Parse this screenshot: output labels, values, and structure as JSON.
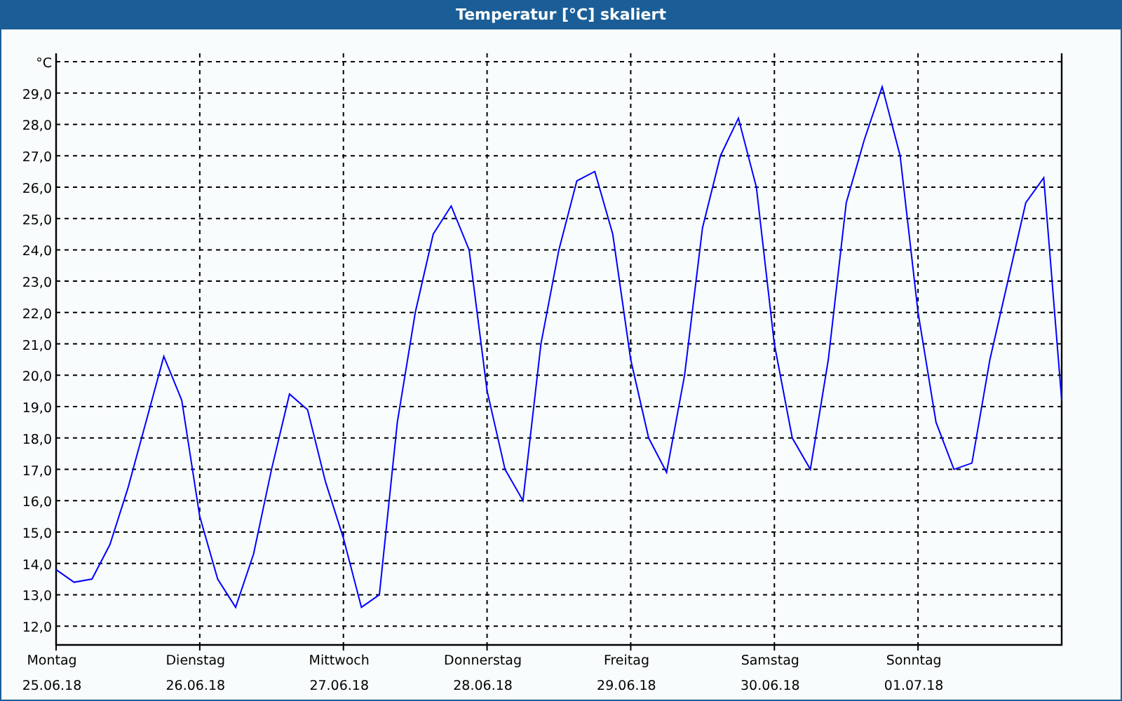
{
  "window": {
    "title": "Temperatur [°C] skaliert"
  },
  "chart": {
    "chart_data": {
      "type": "line",
      "ylabel": "°C",
      "ylim": [
        11.4,
        30
      ],
      "grid": true,
      "categories": [
        "Montag\n25.06.18",
        null,
        null,
        null,
        null,
        null,
        null,
        null,
        "Dienstag\n26.06.18",
        null,
        null,
        null,
        null,
        null,
        null,
        null,
        "Mittwoch\n27.06.18",
        null,
        null,
        null,
        null,
        null,
        null,
        null,
        "Donnerstag\n28.06.18",
        null,
        null,
        null,
        null,
        null,
        null,
        null,
        "Freitag\n29.06.18",
        null,
        null,
        null,
        null,
        null,
        null,
        null,
        "Samstag\n30.06.18",
        null,
        null,
        null,
        null,
        null,
        null,
        null,
        "Sonntag\n01.07.18",
        null,
        null,
        null,
        null,
        null,
        null,
        null,
        null
      ],
      "series": [
        {
          "color": "#0000ff",
          "values": [
            13.8,
            13.4,
            13.5,
            14.6,
            16.4,
            18.5,
            20.6,
            19.2,
            15.5,
            13.5,
            12.6,
            14.3,
            17,
            19.4,
            18.9,
            16.6,
            14.8,
            12.6,
            13,
            18.5,
            22,
            24.5,
            25.4,
            24,
            19.5,
            17,
            16,
            21,
            24,
            26.2,
            26.5,
            24.5,
            20.5,
            18,
            16.9,
            20,
            24.7,
            27,
            28.2,
            26,
            21,
            18,
            17,
            20.5,
            25.5,
            27.5,
            29.2,
            27,
            22,
            18.5,
            17,
            17.2,
            20.5,
            23,
            25.5,
            26.3,
            19.2
          ]
        }
      ],
      "yticks": [
        {
          "value": 12,
          "label": "12,0"
        },
        {
          "value": 13,
          "label": "13,0"
        },
        {
          "value": 14,
          "label": "14,0"
        },
        {
          "value": 15,
          "label": "15,0"
        },
        {
          "value": 16,
          "label": "16,0"
        },
        {
          "value": 17,
          "label": "17,0"
        },
        {
          "value": 18,
          "label": "18,0"
        },
        {
          "value": 19,
          "label": "19,0"
        },
        {
          "value": 20,
          "label": "20,0"
        },
        {
          "value": 21,
          "label": "21,0"
        },
        {
          "value": 22,
          "label": "22,0"
        },
        {
          "value": 23,
          "label": "23,0"
        },
        {
          "value": 24,
          "label": "24,0"
        },
        {
          "value": 25,
          "label": "25,0"
        },
        {
          "value": 26,
          "label": "26,0"
        },
        {
          "value": 27,
          "label": "27,0"
        },
        {
          "value": 28,
          "label": "28,0"
        },
        {
          "value": 29,
          "label": "29,0"
        }
      ]
    }
  }
}
